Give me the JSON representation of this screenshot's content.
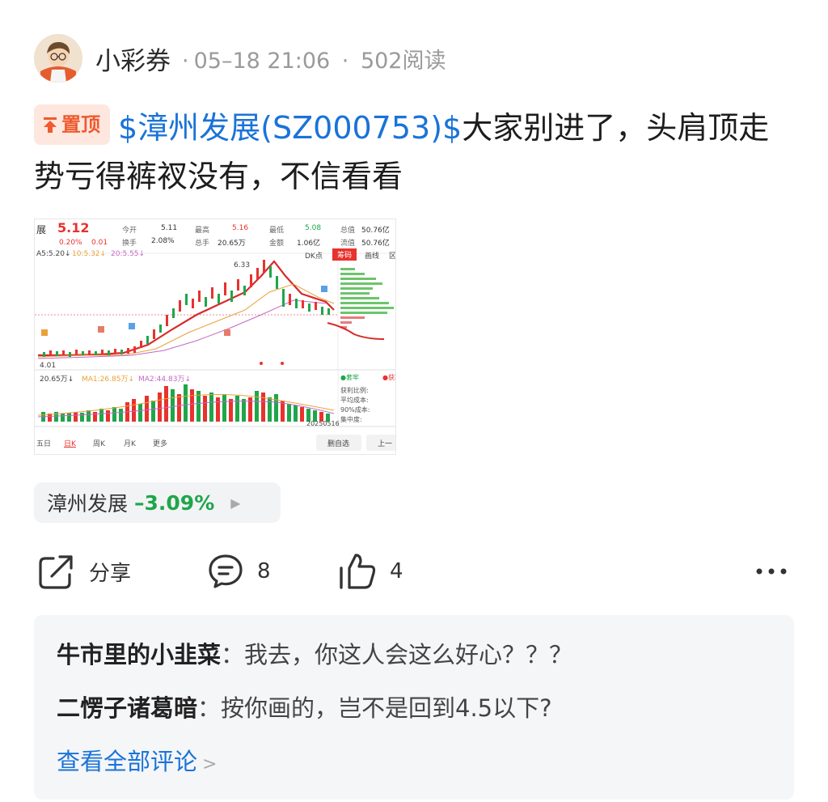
{
  "post": {
    "author": "小彩券",
    "time": "05–18 21:06",
    "reads": "502阅读",
    "pin_label": "置顶",
    "stock_link": "$漳州发展(SZ000753)$",
    "text": "大家别进了，头肩顶走势亏得裤衩没有，不信看看"
  },
  "quote": {
    "name": "展",
    "price": "5.12",
    "change_pct": "0.20%",
    "change_amt": "0.01",
    "open_label": "今开",
    "open": "5.11",
    "turnover_label": "换手",
    "turnover": "2.08%",
    "high_label": "最高",
    "high": "5.16",
    "volume_label": "总手",
    "volume": "20.65万",
    "low_label": "最低",
    "low": "5.08",
    "amount_label": "金额",
    "amount": "1.06亿",
    "mktcap_label": "总值",
    "mktcap": "50.76亿",
    "float_label": "流值",
    "float": "50.76亿",
    "ma5": "A5:5.20↓",
    "ma10": "10:5.32↓",
    "ma20": "20:5.55↓",
    "dk_label": "DK点",
    "tab_chip": "筹码",
    "tab_draw": "画线",
    "tab_more": "区",
    "peak_label": "6.33",
    "low_mark": "4.01",
    "vol_label": "20.65万↓",
    "vol_ma1": "MA1:26.85万↓",
    "vol_ma2": "MA2:44.83万↓",
    "chip_legend_a": "●套牢",
    "chip_legend_b": "●获利",
    "chip_rows": [
      "获利比例:",
      "平均成本:",
      "90%成本:",
      "集中度:"
    ],
    "date": "20250516",
    "period_tabs": [
      "五日",
      "日K",
      "周K",
      "月K",
      "更多"
    ],
    "btn_watch": "删自选",
    "btn_prev": "上一"
  },
  "stock_tag": {
    "name": "漳州发展",
    "change": "–3.09%"
  },
  "actions": {
    "share_label": "分享",
    "comment_count": "8",
    "like_count": "4"
  },
  "comments": [
    {
      "user": "牛市里的小韭菜",
      "text": "：我去，你这人会这么好心？？？"
    },
    {
      "user": "二愣子诸葛暗",
      "text": "：按你画的，岂不是回到4.5以下?"
    }
  ],
  "view_all": "查看全部评论",
  "colors": {
    "link_blue": "#1a73d8",
    "up_red": "#e8322d",
    "down_green": "#1fa64b",
    "pin_orange": "#ef5a2e"
  }
}
